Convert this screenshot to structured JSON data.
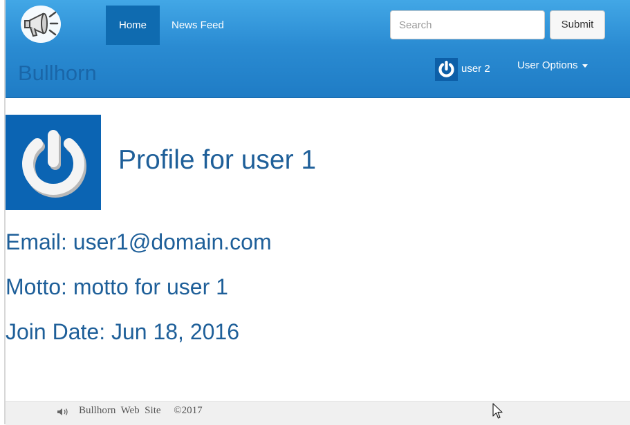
{
  "navbar": {
    "brand": "Bullhorn",
    "logo_icon": "megaphone-icon",
    "links": [
      {
        "label": "Home",
        "active": true
      },
      {
        "label": "News Feed",
        "active": false
      }
    ],
    "search": {
      "placeholder": "Search",
      "value": ""
    },
    "submit_label": "Submit",
    "user": {
      "name": "user 2",
      "avatar_icon": "power-icon"
    },
    "user_options_label": "User Options",
    "colors": {
      "bar": "#2a8bd2",
      "active_tab": "#0f6bb0",
      "brand_text": "#1a66a8"
    }
  },
  "profile": {
    "title": "Profile for user 1",
    "avatar_icon": "power-icon",
    "email_line": "Email: user1@domain.com",
    "motto_line": "Motto: motto for user 1",
    "join_line": "Join Date: Jun 18, 2016",
    "text_color": "#1e5f99"
  },
  "footer": {
    "icon": "speaker-icon",
    "text": "Bullhorn  Web  Site     ©2017"
  }
}
